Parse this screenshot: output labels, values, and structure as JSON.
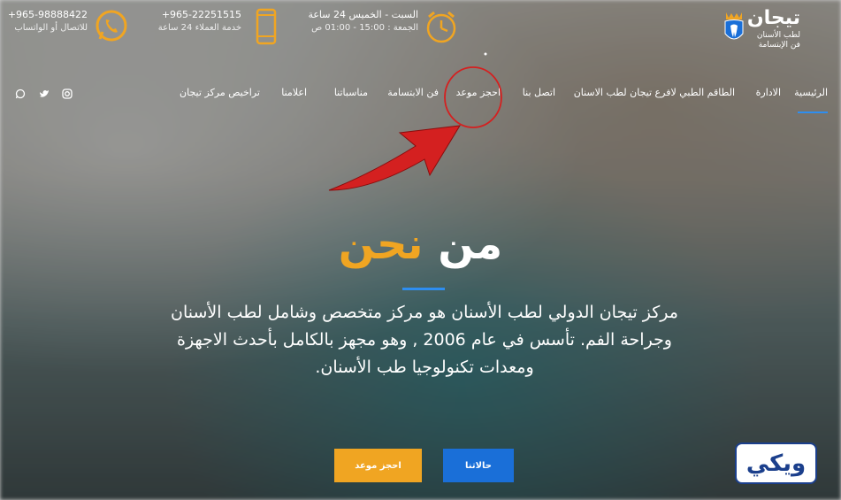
{
  "logo": {
    "name": "تيجان",
    "line2": "لطب الأسنان",
    "line3": "فن الإبتسامة"
  },
  "header": {
    "hours": {
      "main": "السبت - الخميس 24 ساعة",
      "sub": "الجمعة : 15:00 - 01:00 ص"
    },
    "phone": {
      "number": "+965-22251515",
      "label": "خدمة العملاء 24 ساعة"
    },
    "whatsapp": {
      "number": "+965-98888422",
      "label": "للاتصال أو الواتساب"
    }
  },
  "nav": {
    "items": [
      "الرئيسية",
      "الادارة",
      "الطاقم الطبي لافرع تيجان لطب الاسنان",
      "اتصل بنا",
      "احجز موعد",
      "فن الابتسامة",
      "مناسباتنا",
      "اعلامنا",
      "تراخيص مركز تيجان"
    ]
  },
  "hero": {
    "title_main": "من",
    "title_accent": "نحن",
    "text": "مركز تيجان الدولي لطب الأسنان هو مركز متخصص وشامل لطب الأسنان وجراحة الفم. تأسس في عام 2006 , وهو مجهز بالكامل بأحدث الاجهزة ومعدات تكنولوجيا طب الأسنان.",
    "book_button": "احجز موعد",
    "cases_button": "حالاتنا"
  },
  "watermark": "ويكي",
  "colors": {
    "accent": "#f0a522",
    "primary": "#1a6fd8",
    "annotation": "#d42020"
  },
  "icons": [
    "clock-icon",
    "phone-icon",
    "whatsapp-icon",
    "instagram-icon",
    "twitter-icon",
    "whatsapp-small-icon"
  ]
}
